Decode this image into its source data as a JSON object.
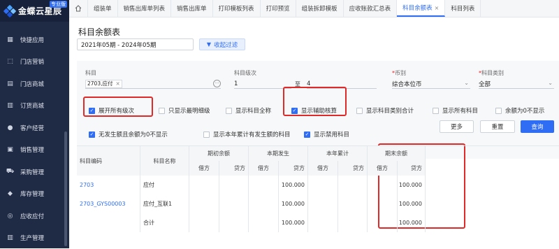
{
  "sidebar": {
    "brand_name": "金蝶云星辰",
    "brand_badge": "专业版",
    "items": [
      {
        "label": "快捷应用",
        "icon": "grid-icon"
      },
      {
        "label": "门店营销",
        "icon": "bag-icon"
      },
      {
        "label": "门店商城",
        "icon": "shop-icon"
      },
      {
        "label": "订货商城",
        "icon": "cart-list-icon"
      },
      {
        "label": "客户经营",
        "icon": "user-icon"
      },
      {
        "label": "销售管理",
        "icon": "wallet-icon"
      },
      {
        "label": "采购管理",
        "icon": "cart-icon"
      },
      {
        "label": "库存管理",
        "icon": "box-icon"
      },
      {
        "label": "应收应付",
        "icon": "money-icon"
      },
      {
        "label": "生产管理",
        "icon": "factory-icon"
      }
    ]
  },
  "tabs": [
    {
      "label": "组装单",
      "active": false
    },
    {
      "label": "销售出库单列表",
      "active": false
    },
    {
      "label": "销售出库单",
      "active": false
    },
    {
      "label": "打印模板列表",
      "active": false
    },
    {
      "label": "打印预览",
      "active": false
    },
    {
      "label": "组装拆卸模板",
      "active": false
    },
    {
      "label": "应收账款汇总表",
      "active": false
    },
    {
      "label": "科目余额表",
      "active": true,
      "close": "×"
    },
    {
      "label": "科目列表",
      "active": false
    }
  ],
  "page": {
    "title": "科目余额表",
    "period": "2021年05期 - 2024年05期",
    "filter_button": "收起过滤"
  },
  "filters": {
    "subject_label": "科目",
    "subject_tag": "2703,应付",
    "level_label": "科目级次",
    "level_from": "1",
    "level_to_label": "至",
    "level_to": "4",
    "currency_label": "币别",
    "currency_value": "综合本位币",
    "category_label": "科目类别",
    "category_value": "全部",
    "req_mark": "*"
  },
  "options": [
    {
      "label": "展开所有级次",
      "checked": true
    },
    {
      "label": "只显示最明细级",
      "checked": false
    },
    {
      "label": "显示科目全称",
      "checked": false
    },
    {
      "label": "显示辅助核算",
      "checked": true
    },
    {
      "label": "显示科目类别合计",
      "checked": false
    },
    {
      "label": "显示所有科目",
      "checked": false
    },
    {
      "label": "余额为0不显示",
      "checked": false
    },
    {
      "label": "无发生额且余额为0不显示",
      "checked": true
    },
    {
      "label": "显示本年累计有发生额的科目",
      "checked": false
    },
    {
      "label": "显示禁用科目",
      "checked": true
    }
  ],
  "buttons": {
    "more": "更多",
    "reset": "重置",
    "query": "查询"
  },
  "table": {
    "col_code": "科目编码",
    "col_name": "科目名称",
    "groups": [
      "期初余额",
      "本期发生",
      "本年累计",
      "期末余额"
    ],
    "debit": "借方",
    "credit": "贷方",
    "rows": [
      {
        "code": "2703",
        "name": "应付",
        "vals": [
          "",
          "",
          "",
          "100.000",
          "",
          "",
          "",
          "100.000"
        ]
      },
      {
        "code": "2703_GYS00003",
        "name": "应付_互联1",
        "vals": [
          "",
          "",
          "",
          "100.000",
          "",
          "",
          "",
          "100.000"
        ]
      },
      {
        "code": "",
        "name": "合计",
        "vals": [
          "",
          "",
          "",
          "100.000",
          "",
          "",
          "",
          "100.000"
        ]
      }
    ]
  },
  "colors": {
    "accent": "#2f6df5",
    "highlight": "#e02a2a",
    "sidebar": "#1f2a44"
  }
}
